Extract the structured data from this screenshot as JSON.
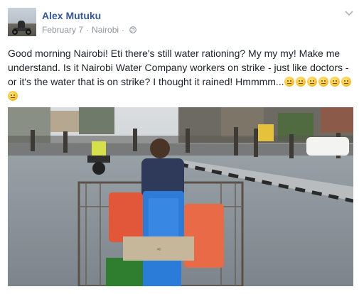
{
  "post": {
    "author": "Alex Mutuku",
    "date": "February 7",
    "separator": "·",
    "location": "Nairobi",
    "separator2": "·",
    "privacy_icon": "globe-icon",
    "menu_icon": "chevron-down-icon",
    "text": "Good morning Nairobi! Eti there's still water rationing? My my my! Make me understand. Is it Nairobi Water Company workers on strike - just like doctors - or it's the water that is on strike? I thought it rained! Hmmmm...",
    "emojis": [
      "unamused-face",
      "expressionless-face",
      "grimacing-face",
      "rolling-eyes-face",
      "smirking-face",
      "persevering-face",
      "sweat-smile-face"
    ],
    "photo": "street-scene-water-cart-photo"
  },
  "colors": {
    "author": "#365899",
    "meta": "#90949c",
    "text": "#1d2129",
    "background": "#ffffff"
  }
}
